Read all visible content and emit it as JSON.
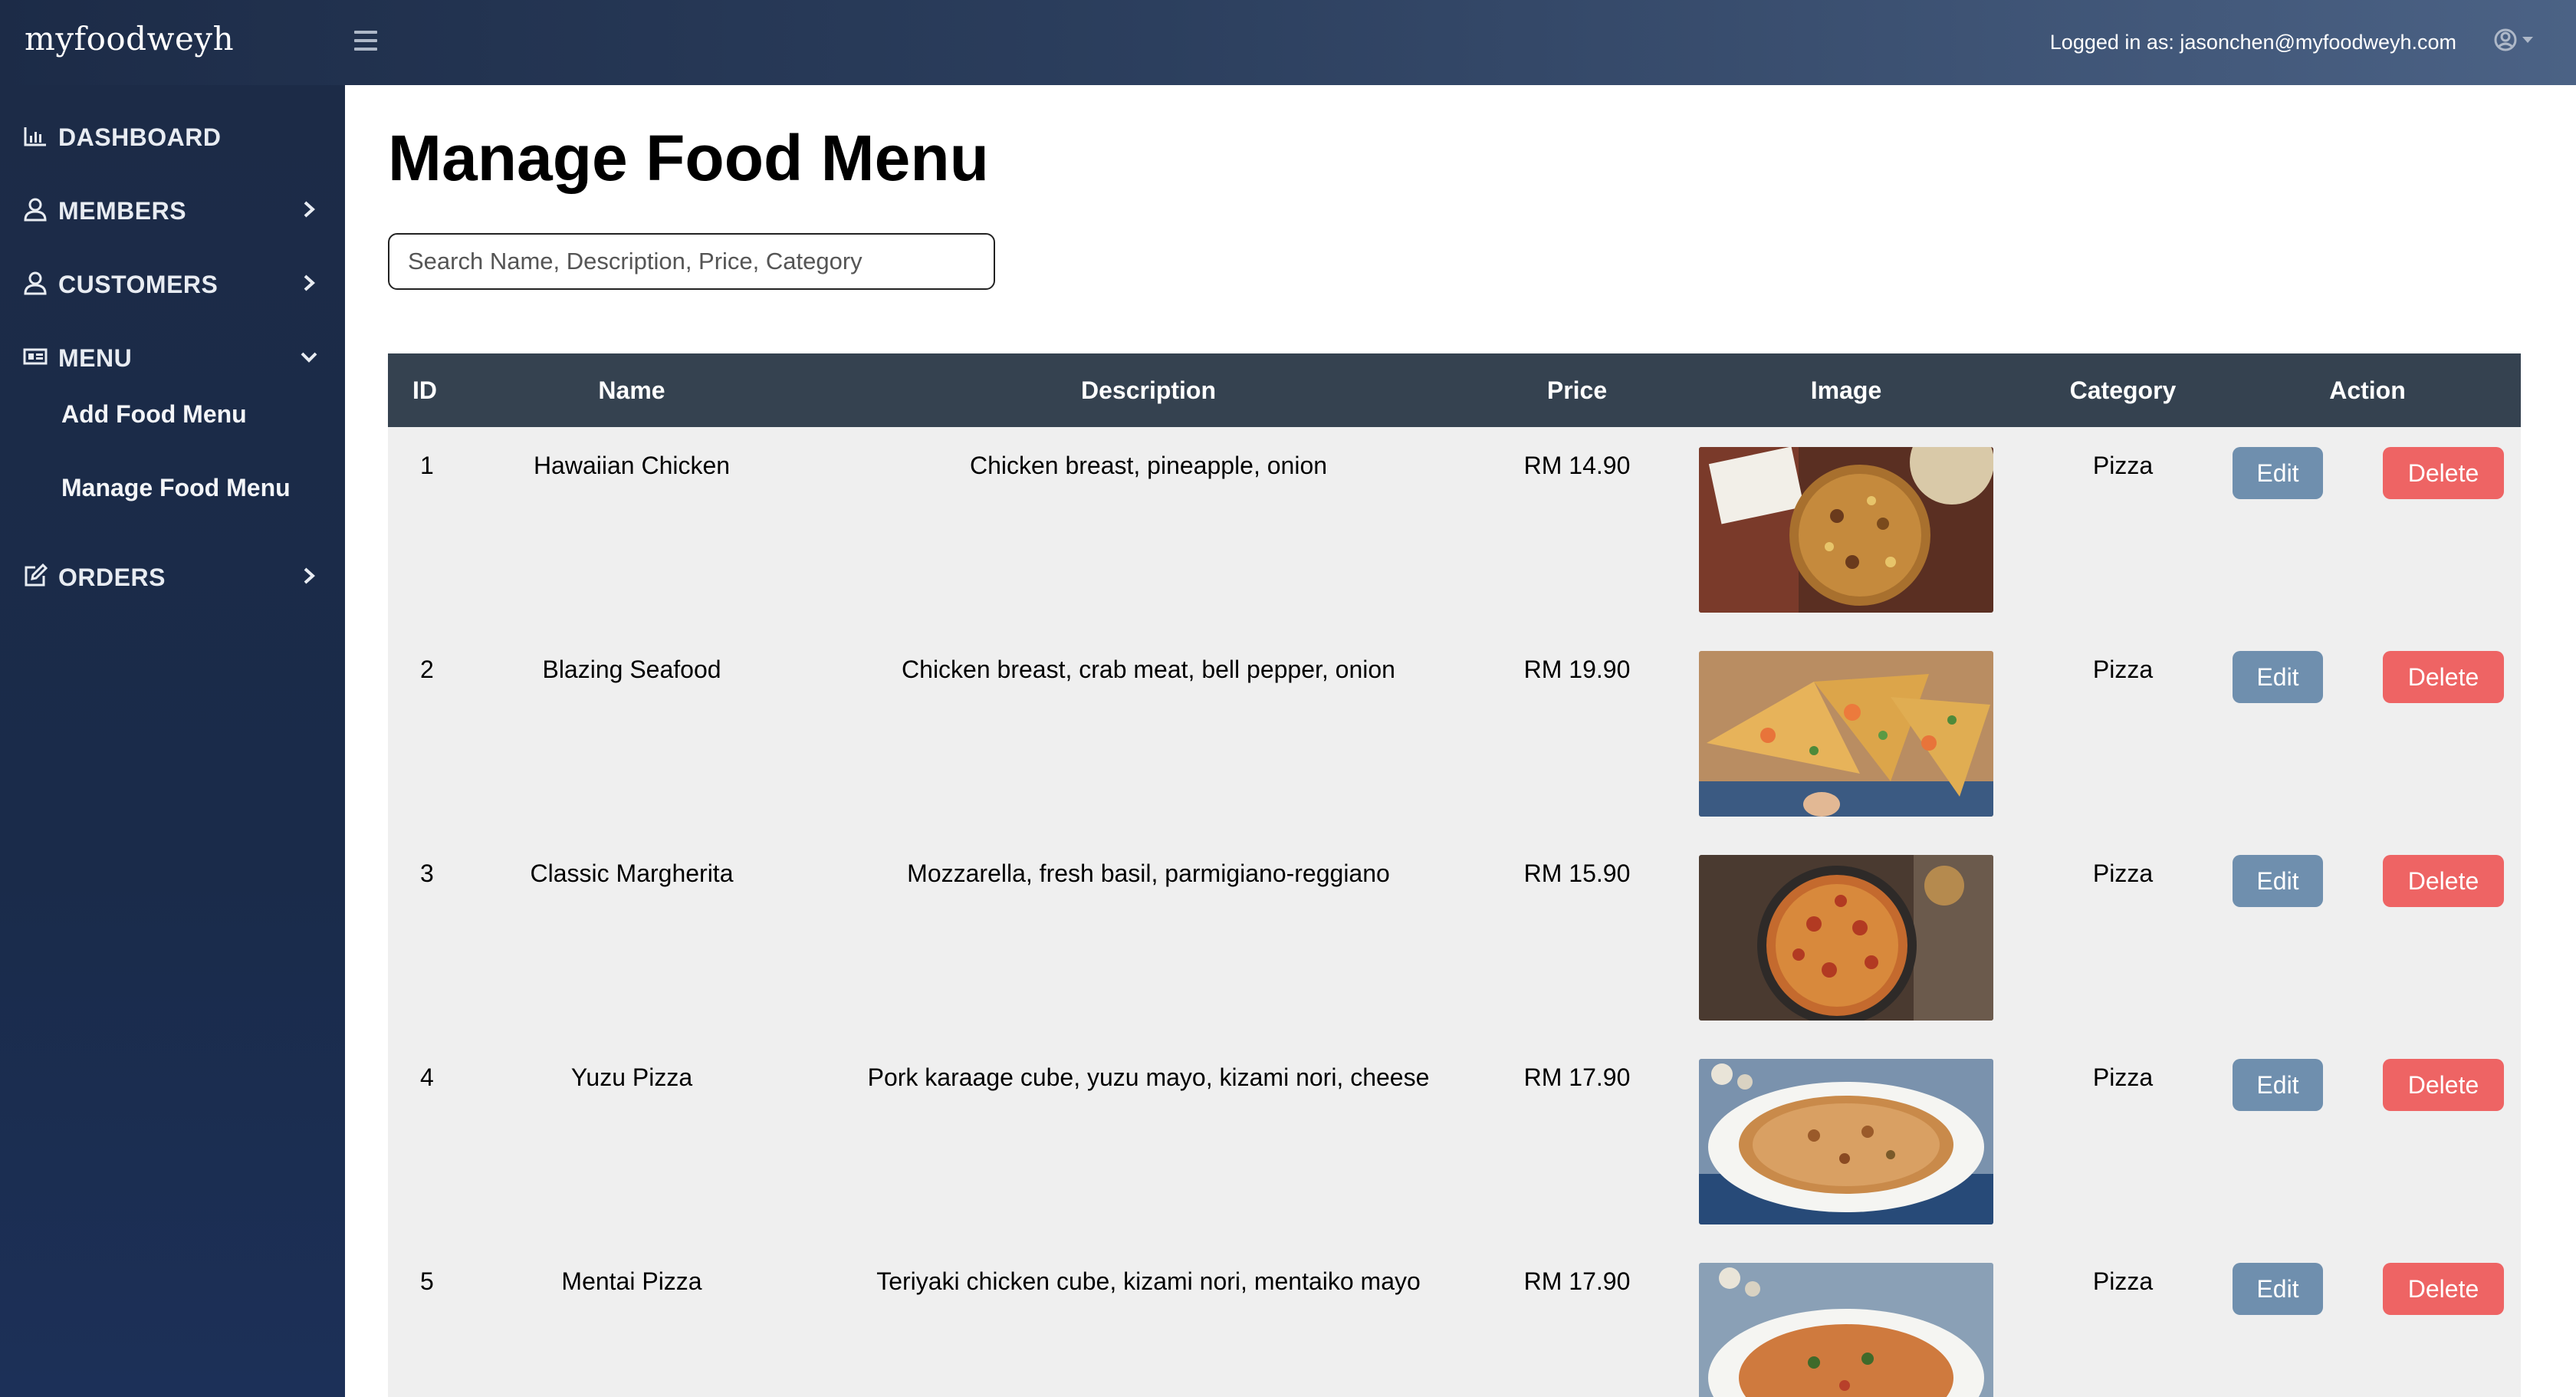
{
  "app": {
    "brand": "myfoodweyh",
    "logged_in_text": "Logged in as: jasonchen@myfoodweyh.com"
  },
  "sidebar": {
    "items": [
      {
        "label": "DASHBOARD",
        "icon": "bar-chart-icon"
      },
      {
        "label": "MEMBERS",
        "icon": "user-icon"
      },
      {
        "label": "CUSTOMERS",
        "icon": "user-icon"
      },
      {
        "label": "MENU",
        "icon": "menu-card-icon"
      },
      {
        "label": "ORDERS",
        "icon": "edit-icon"
      }
    ],
    "menu_sub": [
      {
        "label": "Add Food Menu"
      },
      {
        "label": "Manage Food Menu"
      }
    ]
  },
  "main": {
    "title": "Manage Food Menu",
    "search_placeholder": "Search Name, Description, Price, Category"
  },
  "table": {
    "headers": [
      "ID",
      "Name",
      "Description",
      "Price",
      "Image",
      "Category",
      "Action"
    ],
    "edit_label": "Edit",
    "delete_label": "Delete",
    "rows": [
      {
        "id": "1",
        "name": "Hawaiian Chicken",
        "description": "Chicken breast, pineapple, onion",
        "price": "RM 14.90",
        "category": "Pizza"
      },
      {
        "id": "2",
        "name": "Blazing Seafood",
        "description": "Chicken breast, crab meat, bell pepper, onion",
        "price": "RM 19.90",
        "category": "Pizza"
      },
      {
        "id": "3",
        "name": "Classic Margherita",
        "description": "Mozzarella, fresh basil, parmigiano-reggiano",
        "price": "RM 15.90",
        "category": "Pizza"
      },
      {
        "id": "4",
        "name": "Yuzu Pizza",
        "description": "Pork karaage cube, yuzu mayo, kizami nori, cheese",
        "price": "RM 17.90",
        "category": "Pizza"
      },
      {
        "id": "5",
        "name": "Mentai Pizza",
        "description": "Teriyaki chicken cube, kizami nori, mentaiko mayo",
        "price": "RM 17.90",
        "category": "Pizza"
      }
    ]
  },
  "colors": {
    "topbar": "#1c2b47",
    "sidebar": "#1a2b4a",
    "table_header": "#354250",
    "row_bg": "#efefef",
    "edit_button": "#6f8fae",
    "delete_button": "#ee6464"
  }
}
